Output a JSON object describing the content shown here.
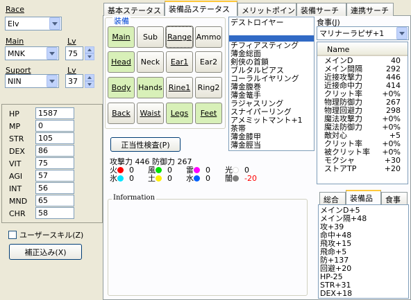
{
  "left": {
    "race_label": "Race",
    "race_value": "Elv",
    "main_label": "Main",
    "main_value": "MNK",
    "main_lv_label": "Lv",
    "main_lv_value": "75",
    "support_label": "Suport",
    "support_value": "NIN",
    "support_lv_label": "Lv",
    "support_lv_value": "37",
    "stats": [
      {
        "label": "HP",
        "value": "1587"
      },
      {
        "label": "MP",
        "value": "0"
      },
      {
        "label": "STR",
        "value": "105"
      },
      {
        "label": "DEX",
        "value": "86"
      },
      {
        "label": "VIT",
        "value": "75"
      },
      {
        "label": "AGI",
        "value": "57"
      },
      {
        "label": "INT",
        "value": "56"
      },
      {
        "label": "MND",
        "value": "65"
      },
      {
        "label": "CHR",
        "value": "58"
      }
    ],
    "user_skill_label": "ユーザースキル(Z)",
    "correction_button": "補正込み(X)"
  },
  "tabs": [
    "基本ステータス",
    "装備品ステータス",
    "メリットポイント",
    "装備サーチ",
    "連携サーチ"
  ],
  "equip": {
    "group_label": "装備",
    "slots": [
      {
        "label": "Main",
        "on": true
      },
      {
        "label": "Sub",
        "on": false
      },
      {
        "label": "Range",
        "on": false
      },
      {
        "label": "Ammo",
        "on": false
      },
      {
        "label": "Head",
        "on": true
      },
      {
        "label": "Neck",
        "on": false
      },
      {
        "label": "Ear1",
        "on": false
      },
      {
        "label": "Ear2",
        "on": false
      },
      {
        "label": "Body",
        "on": true
      },
      {
        "label": "Hands",
        "on": true
      },
      {
        "label": "Rine1",
        "on": false
      },
      {
        "label": "Ring2",
        "on": false
      },
      {
        "label": "Back",
        "on": false
      },
      {
        "label": "Waist",
        "on": false
      },
      {
        "label": "Legs",
        "on": true
      },
      {
        "label": "Feet",
        "on": true
      }
    ],
    "check_button": "正当性検査(P)",
    "attack_label": "攻撃力",
    "attack_value": "446",
    "defense_label": "防御力",
    "defense_value": "267",
    "elements": [
      {
        "label": "火",
        "value": "0",
        "color": "#ff0000"
      },
      {
        "label": "氷",
        "value": "0",
        "color": "#00e5ff"
      },
      {
        "label": "風",
        "value": "0",
        "color": "#00e000"
      },
      {
        "label": "土",
        "value": "0",
        "color": "#ffee00"
      },
      {
        "label": "雷",
        "value": "0",
        "color": "#ff00ff"
      },
      {
        "label": "水",
        "value": "0",
        "color": "#0060ff"
      },
      {
        "label": "光",
        "value": "0",
        "color": "#ffffff"
      },
      {
        "label": "闇",
        "value": "-20",
        "color": "#808080"
      }
    ],
    "info_label": "Information",
    "item_list": [
      "デストロイヤー",
      "",
      "",
      "チフィアスティング",
      "薄金総面",
      "剣侠の首鎖",
      "ブルタルピアス",
      "コーラルイヤリング",
      "薄金腹巻",
      "薄金篭手",
      "ラジャスリング",
      "スナイパーリング",
      "アメミットマント+1",
      "茶帯",
      "薄金膝甲",
      "薄金脛当"
    ]
  },
  "food": {
    "label": "食事(J)",
    "value": "マリナーラピザ+1",
    "column_name": "Name",
    "rows": [
      {
        "name": "メインD",
        "value": "40"
      },
      {
        "name": "メイン間隔",
        "value": "292"
      },
      {
        "name": "近接攻撃力",
        "value": "446"
      },
      {
        "name": "近接命中力",
        "value": "414"
      },
      {
        "name": "クリット率",
        "value": "+0%"
      },
      {
        "name": "物理防御力",
        "value": "267"
      },
      {
        "name": "物理回避力",
        "value": "298"
      },
      {
        "name": "魔法攻撃力",
        "value": "+0%"
      },
      {
        "name": "魔法防御力",
        "value": "+0%"
      },
      {
        "name": "敵対心",
        "value": "+5"
      },
      {
        "name": "クリット率",
        "value": "+0%"
      },
      {
        "name": "被クリット率",
        "value": "+0%"
      },
      {
        "name": "モクシャ",
        "value": "+30"
      },
      {
        "name": "ストアTP",
        "value": "+20"
      }
    ],
    "sub_tabs": [
      "総合",
      "装備品",
      "食事"
    ],
    "bonus_lines": [
      "メインD+5",
      "メイン隔+48",
      "攻+39",
      "命中+48",
      "飛攻+15",
      "飛命+5",
      "防+137",
      "回避+20",
      "HP-25",
      "STR+31",
      "DEX+18"
    ]
  }
}
